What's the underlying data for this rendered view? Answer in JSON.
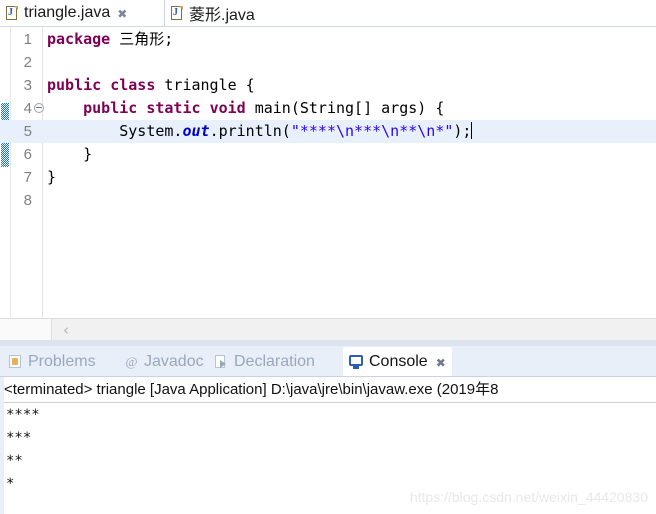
{
  "editor": {
    "tabs": [
      {
        "label": "triangle.java",
        "icon": "java-file-icon",
        "active": true,
        "closable": true,
        "close_glyph": "✖"
      },
      {
        "label": "菱形.java",
        "icon": "java-file-icon",
        "active": false,
        "closable": false,
        "close_glyph": ""
      }
    ],
    "lines": [
      {
        "number": "1",
        "folding": false,
        "highlighted": false,
        "tokens": [
          {
            "text": "package",
            "style": "kw"
          },
          {
            "text": " ",
            "style": "plain"
          },
          {
            "text": "三角形",
            "style": "cn"
          },
          {
            "text": ";",
            "style": "plain"
          }
        ]
      },
      {
        "number": "2",
        "folding": false,
        "highlighted": false,
        "tokens": []
      },
      {
        "number": "3",
        "folding": false,
        "highlighted": false,
        "tokens": [
          {
            "text": "public",
            "style": "kw"
          },
          {
            "text": " ",
            "style": "plain"
          },
          {
            "text": "class",
            "style": "kw"
          },
          {
            "text": " triangle {",
            "style": "plain"
          }
        ]
      },
      {
        "number": "4",
        "folding": true,
        "highlighted": false,
        "tokens": [
          {
            "text": "    ",
            "style": "plain"
          },
          {
            "text": "public",
            "style": "kw"
          },
          {
            "text": " ",
            "style": "plain"
          },
          {
            "text": "static",
            "style": "kw"
          },
          {
            "text": " ",
            "style": "plain"
          },
          {
            "text": "void",
            "style": "kw"
          },
          {
            "text": " main(String[] args) {",
            "style": "plain"
          }
        ]
      },
      {
        "number": "5",
        "folding": false,
        "highlighted": true,
        "caret_at_end": true,
        "tokens": [
          {
            "text": "        System.",
            "style": "plain"
          },
          {
            "text": "out",
            "style": "fld"
          },
          {
            "text": ".println(",
            "style": "plain"
          },
          {
            "text": "\"****\\n***\\n**\\n*\"",
            "style": "str"
          },
          {
            "text": ");",
            "style": "plain"
          }
        ]
      },
      {
        "number": "6",
        "folding": false,
        "highlighted": false,
        "tokens": [
          {
            "text": "    }",
            "style": "plain"
          }
        ]
      },
      {
        "number": "7",
        "folding": false,
        "highlighted": false,
        "tokens": [
          {
            "text": "}",
            "style": "plain"
          }
        ]
      },
      {
        "number": "8",
        "folding": false,
        "highlighted": false,
        "tokens": []
      }
    ],
    "hscroll": {
      "left_arrow_glyph": "‹"
    }
  },
  "console_view": {
    "tabs": [
      {
        "label": "Problems",
        "icon": "problems-icon",
        "active": false,
        "closable": false,
        "close_glyph": ""
      },
      {
        "label": "Javadoc",
        "icon": "javadoc-at-icon",
        "active": false,
        "closable": false,
        "close_glyph": ""
      },
      {
        "label": "Declaration",
        "icon": "declaration-icon",
        "active": false,
        "closable": false,
        "close_glyph": ""
      },
      {
        "label": "Console",
        "icon": "console-icon",
        "active": true,
        "closable": true,
        "close_glyph": "✖"
      }
    ],
    "terminated_line": "<terminated> triangle [Java Application] D:\\java\\jre\\bin\\javaw.exe (2019年8",
    "output_lines": [
      "****",
      "***",
      "**",
      "*"
    ]
  },
  "watermark": {
    "text": "https://blog.csdn.net/weixin_44420830"
  },
  "colors": {
    "keyword": "#7f0055",
    "string": "#2a00ff",
    "field": "#0000c0",
    "line_highlight": "#e8f1fb",
    "change_bar": "#1278d4",
    "tabstrip_bg": "#e9eff9"
  }
}
